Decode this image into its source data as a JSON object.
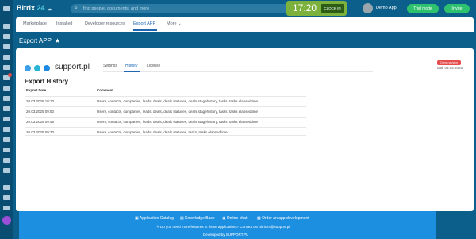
{
  "header": {
    "brand": "Bitrix",
    "brand_num": "24",
    "search_placeholder": "find people, documents, and more",
    "clock_time": "17:20",
    "clock_label": "CLOCK IN",
    "user_name": "Demo App",
    "trial_label": "Trial mode",
    "invite_label": "Invite"
  },
  "nav": {
    "tabs": [
      {
        "label": "Marketplace"
      },
      {
        "label": "Installed"
      },
      {
        "label": "Developer resources"
      },
      {
        "label": "Export APP"
      },
      {
        "label": "More"
      }
    ]
  },
  "page": {
    "title": "Export APP",
    "star": "★"
  },
  "app": {
    "logo_text": "support.pl",
    "tabs": [
      {
        "label": "Settings"
      },
      {
        "label": "History"
      },
      {
        "label": "License"
      }
    ],
    "demo_badge": "Demo version",
    "until": "until 03.04.2025"
  },
  "history": {
    "title": "Export History",
    "columns": [
      "Export Date",
      "Comment"
    ],
    "rows": [
      {
        "date": "20.03.2025 10:10",
        "comment": "Users, contacts, companies, leads, deals, deals statuses, deals stagehistory, tasks, tasks elapsedtime"
      },
      {
        "date": "20.03.2025 09:50",
        "comment": "Users, contacts, companies, leads, deals, deals statuses, deals stagehistory, tasks, tasks elapsedtime"
      },
      {
        "date": "20.03.2025 09:46",
        "comment": "Users, contacts, companies, leads, deals, deals statuses, deals stagehistory, tasks, tasks elapsedtime"
      },
      {
        "date": "20.03.2025 09:30",
        "comment": "Users, contacts, companies, leads, deals, deals statuses, tasks, tasks elapsedtime"
      }
    ]
  },
  "footer": {
    "links": [
      "Application Catalog",
      "Knowledge Base",
      "Online-chat",
      "Order an app development"
    ],
    "question": "Do you need more features in these applications? Contact us!",
    "email": "bitrix24@support.pl",
    "developed_by": "Developed by",
    "developer": "SUPPORT.PL"
  },
  "colors": {
    "header_bg": "#0c5f8a",
    "accent": "#2066b0",
    "green": "#2fc26e",
    "clock": "#7cb13d",
    "footer": "#1d8fe0",
    "demo_badge": "#e54c4c",
    "logo_dot_1": "#3aa0e8",
    "logo_dot_2": "#29b6d6",
    "logo_dot_3": "#1e88e5"
  }
}
